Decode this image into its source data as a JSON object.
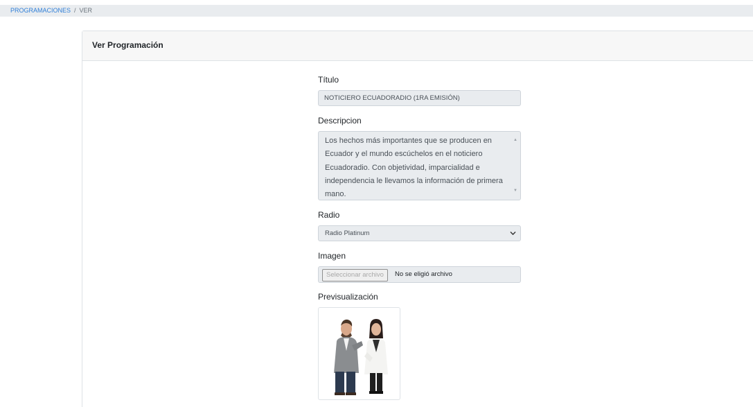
{
  "breadcrumb": {
    "items": [
      "PROGRAMACIONES",
      "VER"
    ],
    "separator": "/"
  },
  "card": {
    "title": "Ver Programación"
  },
  "form": {
    "titulo_label": "Título",
    "titulo_value": "NOTICIERO ECUADORADIO (1RA EMISIÓN)",
    "descripcion_label": "Descripcion",
    "descripcion_value": "Los hechos más importantes que se producen en Ecuador y el mundo escúchelos en el noticiero Ecuadoradio. Con objetividad, imparcialidad e independencia le llevamos la información de primera mano.",
    "radio_label": "Radio",
    "radio_selected": "Radio Platinum",
    "imagen_label": "Imagen",
    "file_button": "Seleccionar archivo",
    "file_status": "No se eligió archivo",
    "preview_label": "Previsualización"
  },
  "colors": {
    "link": "#2f7fd8",
    "readonly_bg": "#e9ecef",
    "header_bg": "#f7f7f7"
  },
  "icons": {
    "select": "chevron-down-icon",
    "scroll_up": "scroll-up-arrow-icon",
    "scroll_down": "scroll-down-arrow-icon"
  }
}
